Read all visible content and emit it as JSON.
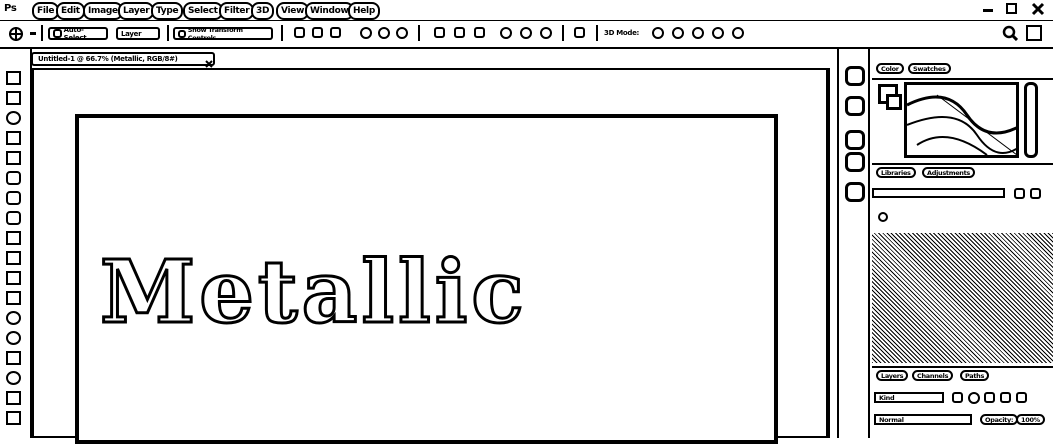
{
  "app": {
    "logo": "Ps"
  },
  "menu": {
    "items": [
      "File",
      "Edit",
      "Image",
      "Layer",
      "Type",
      "Select",
      "Filter",
      "3D",
      "View",
      "Window",
      "Help"
    ]
  },
  "options_bar": {
    "auto_select_label": "Auto-Select",
    "auto_select_target": "Layer",
    "show_transform_label": "Show Transform Controls",
    "mode_label": "3D Mode:"
  },
  "document": {
    "tab_title": "Untitled-1 @ 66.7% (Metallic, RGB/8#)",
    "text_content": "Metallic"
  },
  "panels": {
    "color_tabs": [
      "Color",
      "Swatches"
    ],
    "libraries_tabs": [
      "Libraries",
      "Adjustments"
    ],
    "layers_tabs": [
      "Layers",
      "Channels",
      "Paths"
    ],
    "layer_filter": "Kind",
    "blend_mode": "Normal",
    "opacity_label": "Opacity:",
    "opacity_value": "100%"
  },
  "icons": {
    "window_controls": [
      "minimize-icon",
      "maximize-icon",
      "close-icon"
    ],
    "search": "search-icon",
    "workspace": "workspace-icon"
  }
}
